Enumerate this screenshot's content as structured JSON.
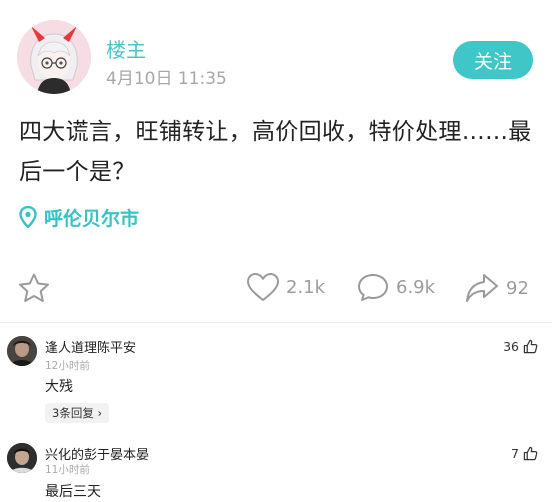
{
  "post": {
    "author": "楼主",
    "time": "4月10日 11:35",
    "follow_label": "关注",
    "body": "四大谎言，旺铺转让，高价回收，特价处理……最后一个是？",
    "location": "呼伦贝尔市"
  },
  "actions": {
    "likes": "2.1k",
    "comments": "6.9k",
    "shares": "92"
  },
  "comments": [
    {
      "name": "逢人道理陈平安",
      "time": "12小时前",
      "text": "大残",
      "likes": "36",
      "replies": "3条回复 ›"
    },
    {
      "name": "兴化的彭于晏本晏",
      "time": "11小时前",
      "text": "最后三天",
      "likes": "7"
    }
  ],
  "colors": {
    "accent": "#3fc7c8",
    "name": "#4cc4c8",
    "muted": "#a7a7a7"
  }
}
